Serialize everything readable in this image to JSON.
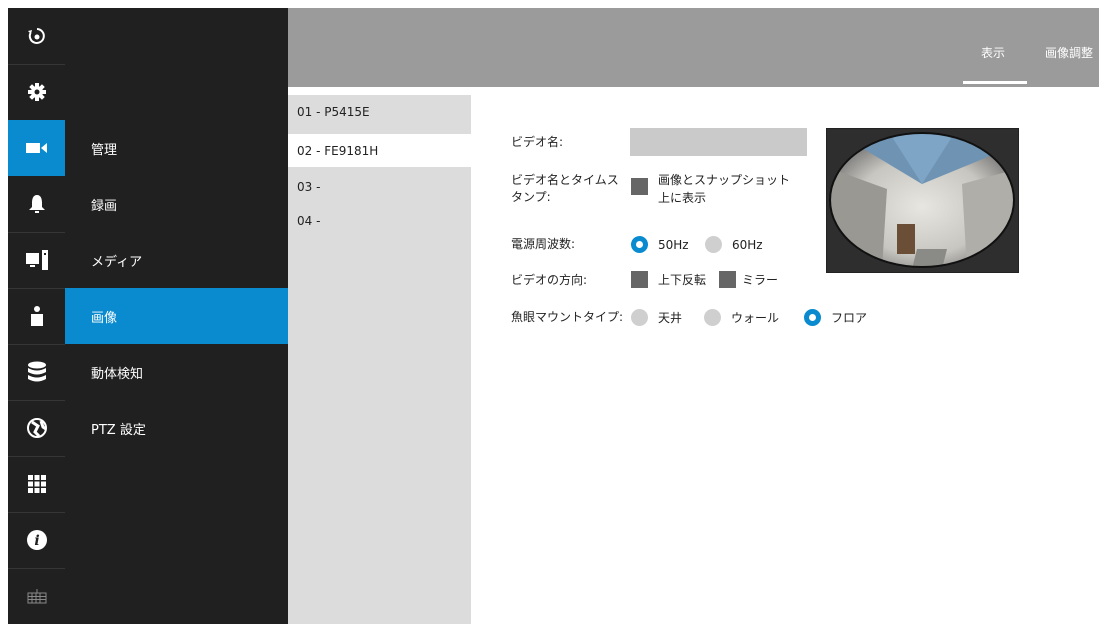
{
  "rail": {
    "icons": [
      "refresh-eye-icon",
      "gear-icon",
      "video-camera-icon",
      "bell-icon",
      "monitor-icon",
      "person-icon",
      "database-icon",
      "globe-icon",
      "grid-icon",
      "info-icon",
      "keyboard-icon"
    ],
    "active_index": 2
  },
  "submenu": {
    "items": [
      {
        "label": "管理"
      },
      {
        "label": "録画"
      },
      {
        "label": "メディア"
      },
      {
        "label": "画像"
      },
      {
        "label": "動体検知"
      },
      {
        "label": "PTZ 設定"
      }
    ],
    "active_index": 3
  },
  "tabs": [
    {
      "label": "表示",
      "active": true
    },
    {
      "label": "画像調整",
      "active": false
    }
  ],
  "devices": [
    {
      "label": "01 - P5415E"
    },
    {
      "label": "02 - FE9181H"
    },
    {
      "label": "03 -"
    },
    {
      "label": "04 -"
    }
  ],
  "active_device_index": 1,
  "form": {
    "video_name_label": "ビデオ名:",
    "video_name_value": "",
    "timestamp_label_1": "ビデオ名とタイムス",
    "timestamp_label_2": "タンプ:",
    "timestamp_option_1": "画像とスナップショット",
    "timestamp_option_2": "上に表示",
    "power_freq_label": "電源周波数:",
    "power_freq_options": [
      "50Hz",
      "60Hz"
    ],
    "power_freq_selected": "50Hz",
    "orientation_label": "ビデオの方向:",
    "orientation_flip": "上下反転",
    "orientation_mirror": "ミラー",
    "mount_label": "魚眼マウントタイプ:",
    "mount_options": [
      "天井",
      "ウォール",
      "フロア"
    ],
    "mount_selected": "フロア"
  },
  "colors": {
    "accent": "#0a8bd0",
    "sidebar_bg": "#202020",
    "header_bg": "#9b9b9b",
    "list_bg": "#dcdcdc"
  }
}
